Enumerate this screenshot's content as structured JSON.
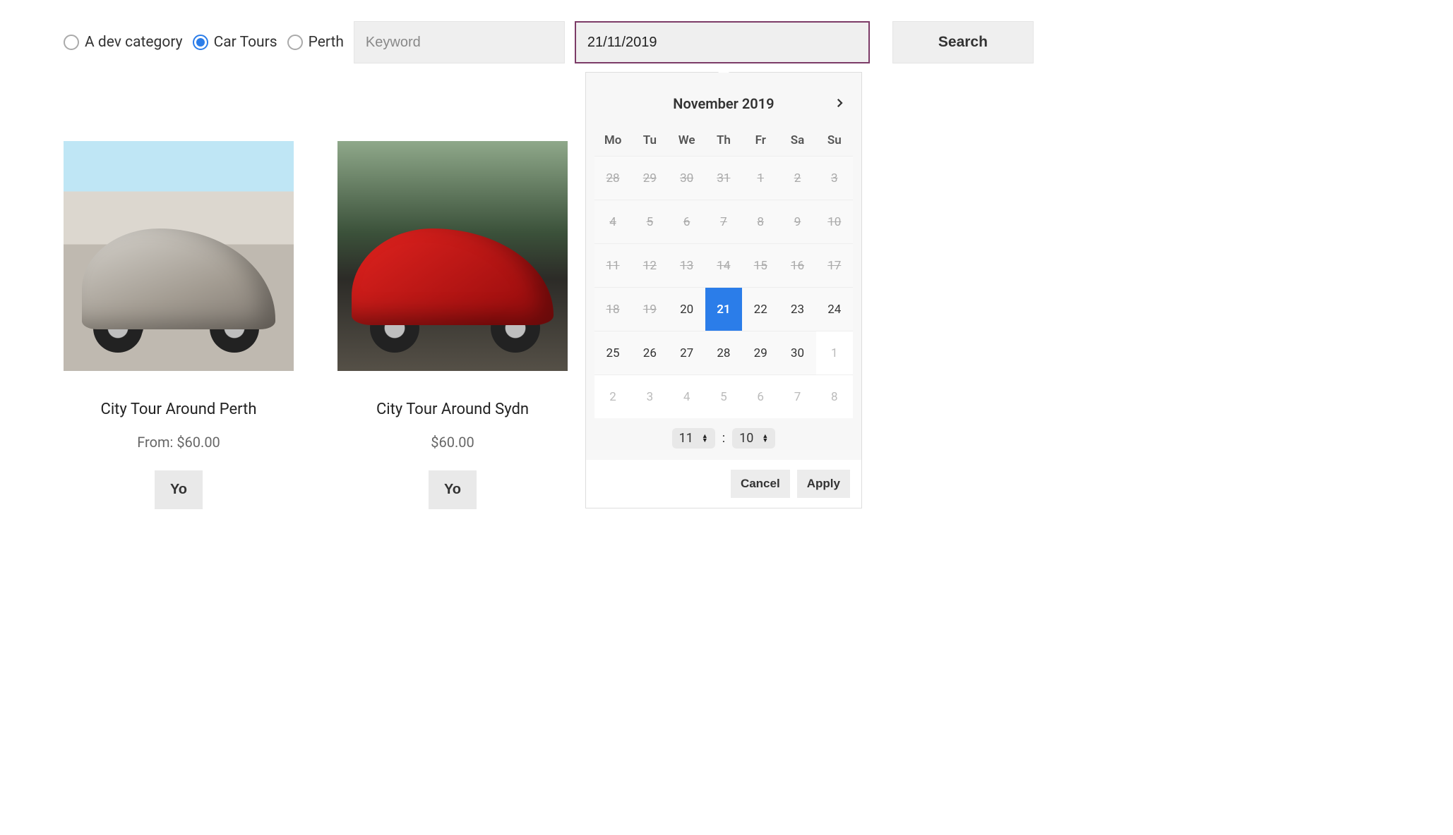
{
  "filters": {
    "categories": [
      {
        "label": "A dev category",
        "selected": false
      },
      {
        "label": "Car Tours",
        "selected": true
      },
      {
        "label": "Perth",
        "selected": false
      }
    ],
    "keyword_placeholder": "Keyword",
    "date_value": "21/11/2019",
    "search_label": "Search"
  },
  "calendar": {
    "month_label": "November 2019",
    "dow": [
      "Mo",
      "Tu",
      "We",
      "Th",
      "Fr",
      "Sa",
      "Su"
    ],
    "weeks": [
      [
        {
          "d": "28",
          "disabled": true
        },
        {
          "d": "29",
          "disabled": true
        },
        {
          "d": "30",
          "disabled": true
        },
        {
          "d": "31",
          "disabled": true
        },
        {
          "d": "1",
          "disabled": true
        },
        {
          "d": "2",
          "disabled": true
        },
        {
          "d": "3",
          "disabled": true
        }
      ],
      [
        {
          "d": "4",
          "disabled": true
        },
        {
          "d": "5",
          "disabled": true
        },
        {
          "d": "6",
          "disabled": true
        },
        {
          "d": "7",
          "disabled": true
        },
        {
          "d": "8",
          "disabled": true
        },
        {
          "d": "9",
          "disabled": true
        },
        {
          "d": "10",
          "disabled": true
        }
      ],
      [
        {
          "d": "11",
          "disabled": true
        },
        {
          "d": "12",
          "disabled": true
        },
        {
          "d": "13",
          "disabled": true
        },
        {
          "d": "14",
          "disabled": true
        },
        {
          "d": "15",
          "disabled": true
        },
        {
          "d": "16",
          "disabled": true
        },
        {
          "d": "17",
          "disabled": true
        }
      ],
      [
        {
          "d": "18",
          "disabled": true
        },
        {
          "d": "19",
          "disabled": true
        },
        {
          "d": "20"
        },
        {
          "d": "21",
          "selected": true
        },
        {
          "d": "22"
        },
        {
          "d": "23"
        },
        {
          "d": "24"
        }
      ],
      [
        {
          "d": "25"
        },
        {
          "d": "26"
        },
        {
          "d": "27"
        },
        {
          "d": "28"
        },
        {
          "d": "29"
        },
        {
          "d": "30"
        },
        {
          "d": "1",
          "outside": true
        }
      ],
      [
        {
          "d": "2",
          "outside": true
        },
        {
          "d": "3",
          "outside": true
        },
        {
          "d": "4",
          "outside": true
        },
        {
          "d": "5",
          "outside": true
        },
        {
          "d": "6",
          "outside": true
        },
        {
          "d": "7",
          "outside": true
        },
        {
          "d": "8",
          "outside": true
        }
      ]
    ],
    "time": {
      "hour": "11",
      "minute": "10",
      "separator": ":"
    },
    "cancel_label": "Cancel",
    "apply_label": "Apply"
  },
  "products": [
    {
      "title": "City Tour Around Perth",
      "price": "From: $60.00",
      "button": "Yo",
      "img": "silver"
    },
    {
      "title": "City Tour Around Sydn",
      "price": "$60.00",
      "button": "Yo",
      "img": "red"
    }
  ]
}
